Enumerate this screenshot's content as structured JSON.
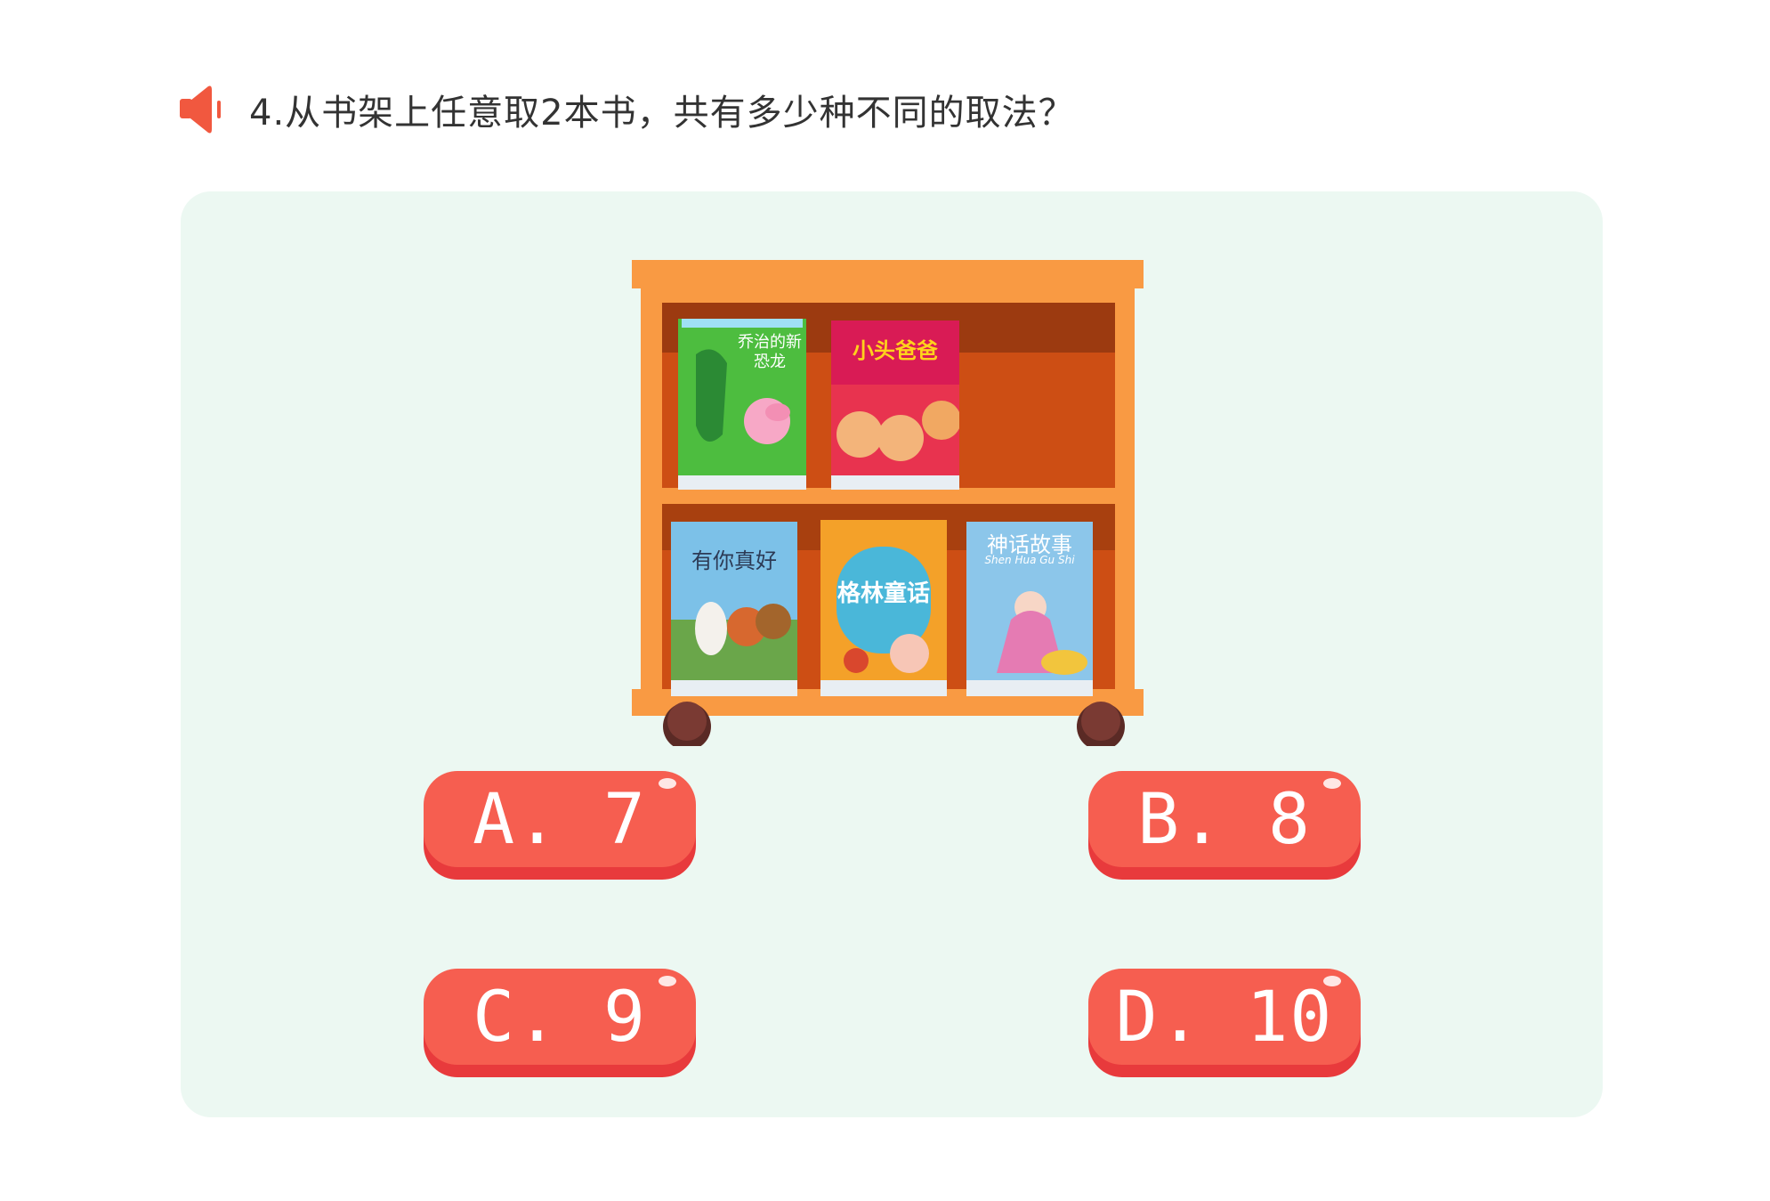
{
  "question": {
    "text": "4.从书架上任意取2本书，共有多少种不同的取法？",
    "speaker_icon": "speaker-icon"
  },
  "colors": {
    "panel_bg": "#ecf8f2",
    "shelf_orange": "#f99a43",
    "shelf_inner": "#cd4e14",
    "button_red": "#f0494a",
    "button_text": "#ffffff"
  },
  "bookshelf": {
    "top_row": [
      {
        "cover_text": "乔治的新恐龙",
        "cover_color": "#4dbd3f"
      },
      {
        "cover_text": "小头爸爸",
        "cover_color": "#e8334f"
      }
    ],
    "bottom_row": [
      {
        "cover_text": "有你真好",
        "cover_color": "#7cc1e8"
      },
      {
        "cover_text": "格林童话",
        "cover_color": "#f4a129"
      },
      {
        "cover_text": "神话故事",
        "cover_sub": "Shen Hua Gu Shi",
        "cover_color": "#8cc6ea"
      }
    ]
  },
  "options": [
    {
      "label": "A. 7"
    },
    {
      "label": "B. 8"
    },
    {
      "label": "C. 9"
    },
    {
      "label": "D. 10"
    }
  ]
}
